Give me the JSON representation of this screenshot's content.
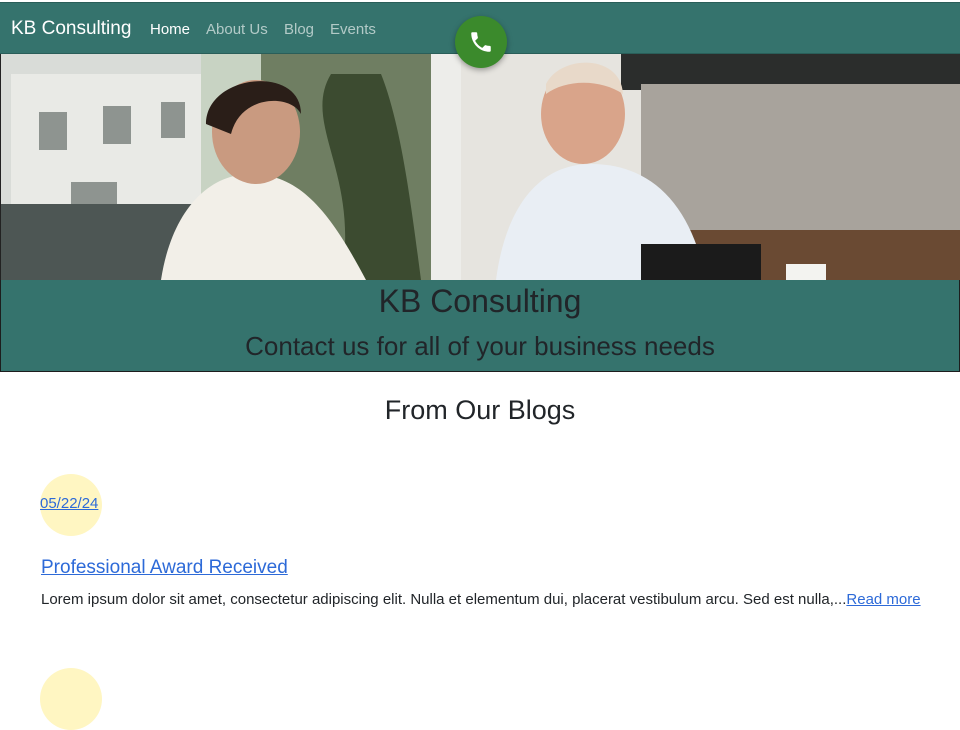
{
  "navbar": {
    "brand": "KB Consulting",
    "links": [
      {
        "label": "Home",
        "active": true
      },
      {
        "label": "About Us",
        "active": false
      },
      {
        "label": "Blog",
        "active": false
      },
      {
        "label": "Events",
        "active": false
      }
    ],
    "call_icon": "phone-icon"
  },
  "hero": {
    "image": "photo-of-two-people-meeting-in-office"
  },
  "banner": {
    "title": "KB Consulting",
    "subtitle": "Contact us for all of your business needs"
  },
  "blogs": {
    "heading": "From Our Blogs",
    "posts": [
      {
        "date": "05/22/24",
        "title": "Professional Award Received",
        "excerpt": "Lorem ipsum dolor sit amet, consectetur adipiscing elit. Nulla et elementum dui, placerat vestibulum arcu. Sed est nulla,...",
        "read_more": "Read more"
      }
    ]
  },
  "colors": {
    "brand_teal": "#35736d",
    "call_green": "#3b8a2c",
    "link_blue": "#2d6ad8",
    "date_circle": "#fff6c2"
  }
}
